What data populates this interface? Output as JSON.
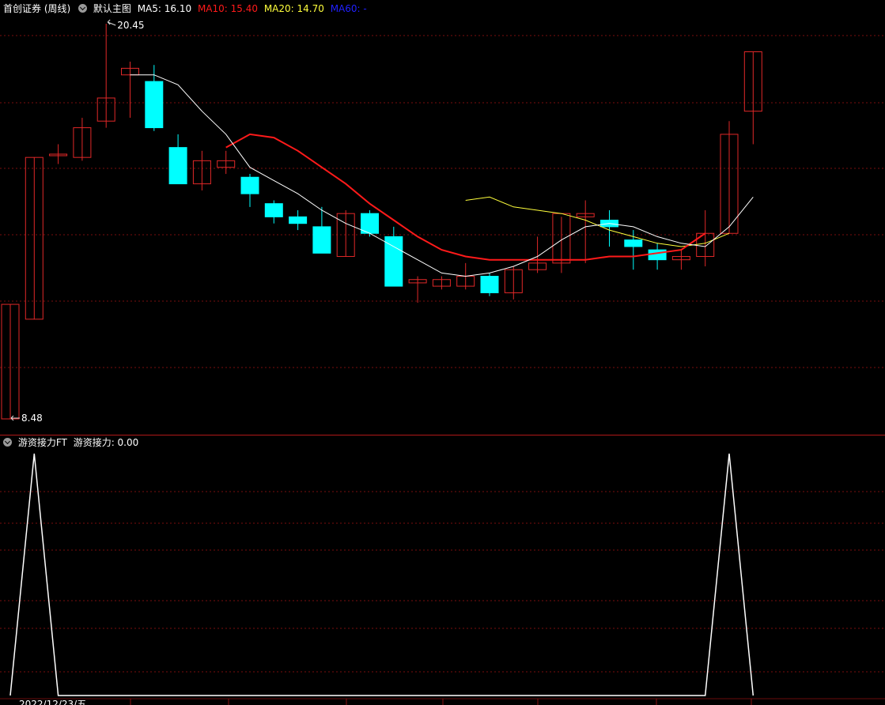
{
  "main_legend": {
    "stock": "首创证券 (周线)",
    "template": "默认主图",
    "ma5": "MA5: 16.10",
    "ma10": "MA10: 15.40",
    "ma20": "MA20: 14.70",
    "ma60": "MA60: -"
  },
  "main_chart": {
    "high_label": "20.45",
    "low_label": "8.48",
    "price_range": [
      8.48,
      20.45
    ],
    "candles": [
      {
        "o": 8.48,
        "h": 11.95,
        "l": 8.48,
        "c": 11.95
      },
      {
        "o": 11.5,
        "h": 16.4,
        "l": 11.5,
        "c": 16.4
      },
      {
        "o": 16.5,
        "h": 16.8,
        "l": 16.2,
        "c": 16.5
      },
      {
        "o": 16.4,
        "h": 17.6,
        "l": 16.3,
        "c": 17.3
      },
      {
        "o": 17.5,
        "h": 20.45,
        "l": 17.3,
        "c": 18.2
      },
      {
        "o": 18.9,
        "h": 19.3,
        "l": 17.6,
        "c": 19.1
      },
      {
        "o": 18.7,
        "h": 19.2,
        "l": 17.2,
        "c": 17.3
      },
      {
        "o": 16.7,
        "h": 17.1,
        "l": 15.6,
        "c": 15.6
      },
      {
        "o": 15.6,
        "h": 16.6,
        "l": 15.4,
        "c": 16.3
      },
      {
        "o": 16.1,
        "h": 16.6,
        "l": 15.9,
        "c": 16.3
      },
      {
        "o": 15.8,
        "h": 15.9,
        "l": 14.9,
        "c": 15.3
      },
      {
        "o": 15.0,
        "h": 15.1,
        "l": 14.4,
        "c": 14.6
      },
      {
        "o": 14.6,
        "h": 14.8,
        "l": 14.2,
        "c": 14.4
      },
      {
        "o": 14.3,
        "h": 14.9,
        "l": 14.0,
        "c": 13.5
      },
      {
        "o": 13.4,
        "h": 14.8,
        "l": 13.4,
        "c": 14.7
      },
      {
        "o": 14.7,
        "h": 14.8,
        "l": 14.0,
        "c": 14.1
      },
      {
        "o": 14.0,
        "h": 14.3,
        "l": 12.6,
        "c": 12.5
      },
      {
        "o": 12.6,
        "h": 12.8,
        "l": 12.0,
        "c": 12.7
      },
      {
        "o": 12.5,
        "h": 12.8,
        "l": 12.4,
        "c": 12.7
      },
      {
        "o": 12.5,
        "h": 13.2,
        "l": 12.4,
        "c": 12.8
      },
      {
        "o": 12.8,
        "h": 12.9,
        "l": 12.2,
        "c": 12.3
      },
      {
        "o": 12.3,
        "h": 13.1,
        "l": 12.1,
        "c": 13.0
      },
      {
        "o": 13.0,
        "h": 14.0,
        "l": 12.9,
        "c": 13.2
      },
      {
        "o": 13.2,
        "h": 14.6,
        "l": 12.9,
        "c": 14.7
      },
      {
        "o": 14.6,
        "h": 15.1,
        "l": 13.2,
        "c": 14.7
      },
      {
        "o": 14.5,
        "h": 14.8,
        "l": 13.7,
        "c": 14.3
      },
      {
        "o": 13.9,
        "h": 14.2,
        "l": 13.0,
        "c": 13.7
      },
      {
        "o": 13.6,
        "h": 13.8,
        "l": 13.0,
        "c": 13.3
      },
      {
        "o": 13.3,
        "h": 13.6,
        "l": 13.0,
        "c": 13.4
      },
      {
        "o": 13.4,
        "h": 14.8,
        "l": 13.1,
        "c": 14.1
      },
      {
        "o": 14.1,
        "h": 17.5,
        "l": 14.1,
        "c": 17.1
      },
      {
        "o": 17.8,
        "h": 19.6,
        "l": 16.8,
        "c": 19.6
      }
    ],
    "ma5": [
      null,
      null,
      null,
      null,
      null,
      18.9,
      18.9,
      18.6,
      17.8,
      17.1,
      16.1,
      15.7,
      15.3,
      14.8,
      14.4,
      14.1,
      13.7,
      13.3,
      12.9,
      12.8,
      12.9,
      13.1,
      13.4,
      13.9,
      14.3,
      14.4,
      14.3,
      14.0,
      13.8,
      13.7,
      14.3,
      15.2
    ],
    "ma10": [
      null,
      null,
      null,
      null,
      null,
      null,
      null,
      null,
      null,
      16.7,
      17.1,
      17.0,
      16.6,
      16.1,
      15.6,
      15.0,
      14.5,
      14.0,
      13.6,
      13.4,
      13.3,
      13.3,
      13.3,
      13.3,
      13.3,
      13.4,
      13.4,
      13.5,
      13.6,
      14.1
    ],
    "ma20": [
      null,
      null,
      null,
      null,
      null,
      null,
      null,
      null,
      null,
      null,
      null,
      null,
      null,
      null,
      null,
      null,
      null,
      null,
      null,
      15.1,
      15.2,
      14.9,
      14.8,
      14.7,
      14.5,
      14.2,
      14.0,
      13.8,
      13.7,
      13.8,
      14.1
    ]
  },
  "sub_legend": {
    "name": "游资接力FT",
    "value": "游资接力: 0.00"
  },
  "sub_chart": {
    "values": [
      0,
      1,
      0,
      0,
      0,
      0,
      0,
      0,
      0,
      0,
      0,
      0,
      0,
      0,
      0,
      0,
      0,
      0,
      0,
      0,
      0,
      0,
      0,
      0,
      0,
      0,
      0,
      0,
      0,
      0,
      1,
      0
    ]
  },
  "bottom_axis": {
    "date_label": "2022/12/23/五"
  },
  "colors": {
    "up": "#e02828",
    "down": "#00ffff",
    "ma5": "#ffffff",
    "ma10": "#ff1a1a",
    "ma20": "#ffff3c",
    "ma60": "#0000ff",
    "grid": "#7a0e0e"
  }
}
